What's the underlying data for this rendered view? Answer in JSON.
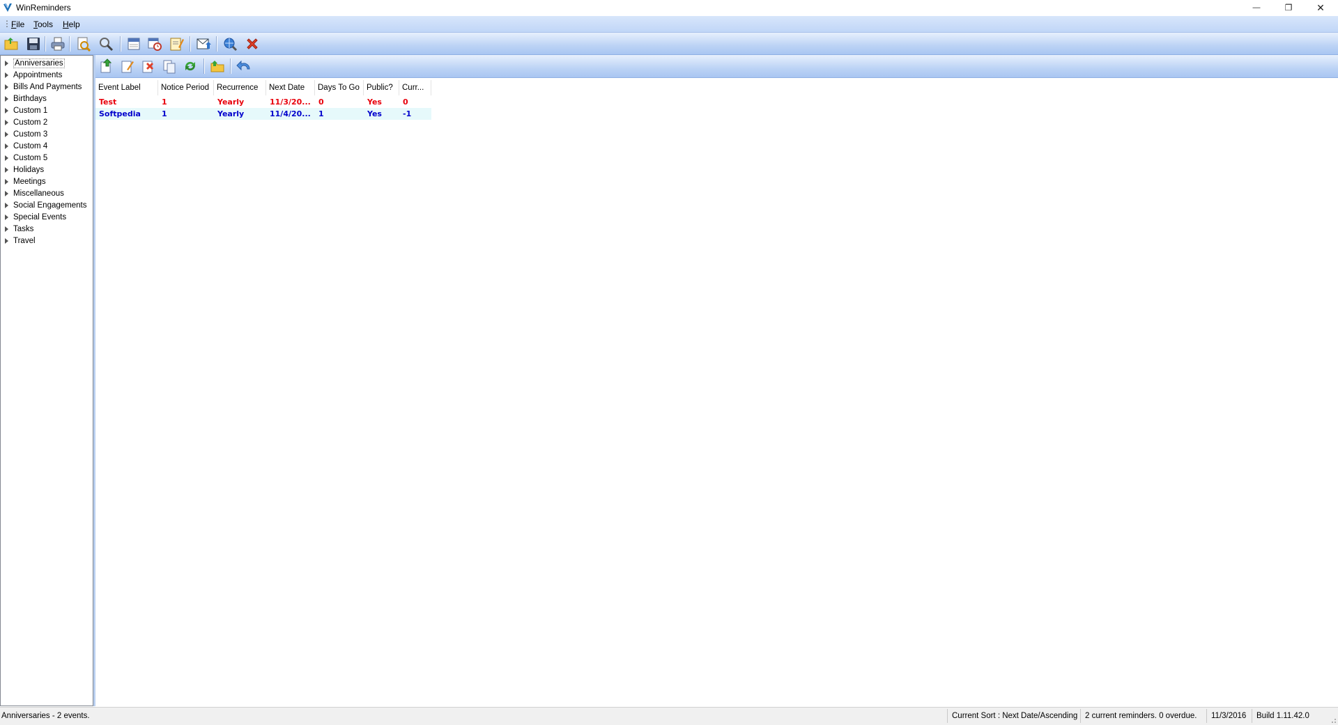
{
  "window": {
    "title": "WinReminders",
    "minimize_glyph": "—",
    "restore_glyph": "❐",
    "close_glyph": "✕"
  },
  "menu": {
    "grip": "⋮",
    "items": [
      {
        "underline": "F",
        "rest": "ile"
      },
      {
        "underline": "T",
        "rest": "ools"
      },
      {
        "underline": "H",
        "rest": "elp"
      }
    ]
  },
  "toolbar_main": {
    "icons": [
      "open-folder-icon",
      "save-icon",
      "print-icon",
      "print-preview-icon",
      "find-icon",
      "calendar-icon",
      "calendar-clock-icon",
      "notes-icon",
      "reminder-alert-icon",
      "search-globe-icon",
      "exit-icon"
    ]
  },
  "toolbar_events": {
    "icons": [
      "add-event-icon",
      "edit-event-icon",
      "delete-event-icon",
      "copy-event-icon",
      "refresh-event-icon",
      "move-category-icon",
      "undo-arrow-icon"
    ]
  },
  "categories": [
    "Anniversaries",
    "Appointments",
    "Bills And Payments",
    "Birthdays",
    "Custom 1",
    "Custom 2",
    "Custom 3",
    "Custom 4",
    "Custom 5",
    "Holidays",
    "Meetings",
    "Miscellaneous",
    "Social Engagements",
    "Special Events",
    "Tasks",
    "Travel"
  ],
  "selected_category": "Anniversaries",
  "grid": {
    "columns": [
      "Event Label",
      "Notice Period",
      "Recurrence",
      "Next Date",
      "Days To Go",
      "Public?",
      "Curr..."
    ],
    "rows": [
      {
        "cells": [
          "Test",
          "1",
          "Yearly",
          "11/3/20...",
          "0",
          "Yes",
          "0"
        ],
        "color": "#e8000b"
      },
      {
        "cells": [
          "Softpedia",
          "1",
          "Yearly",
          "11/4/20...",
          "1",
          "Yes",
          "-1"
        ],
        "color": "#0000cc"
      }
    ]
  },
  "status": {
    "left": "Anniversaries - 2 events.",
    "sort": "Current Sort : Next Date/Ascending",
    "summary": "2 current reminders. 0 overdue.",
    "date": "11/3/2016",
    "build": "Build 1.11.42.0"
  },
  "colors": {
    "toolbar_bg": "#bcd3f5",
    "overdue_red": "#e8000b",
    "upcoming_blue": "#0000cc",
    "alt_row": "#e6f9fb"
  }
}
